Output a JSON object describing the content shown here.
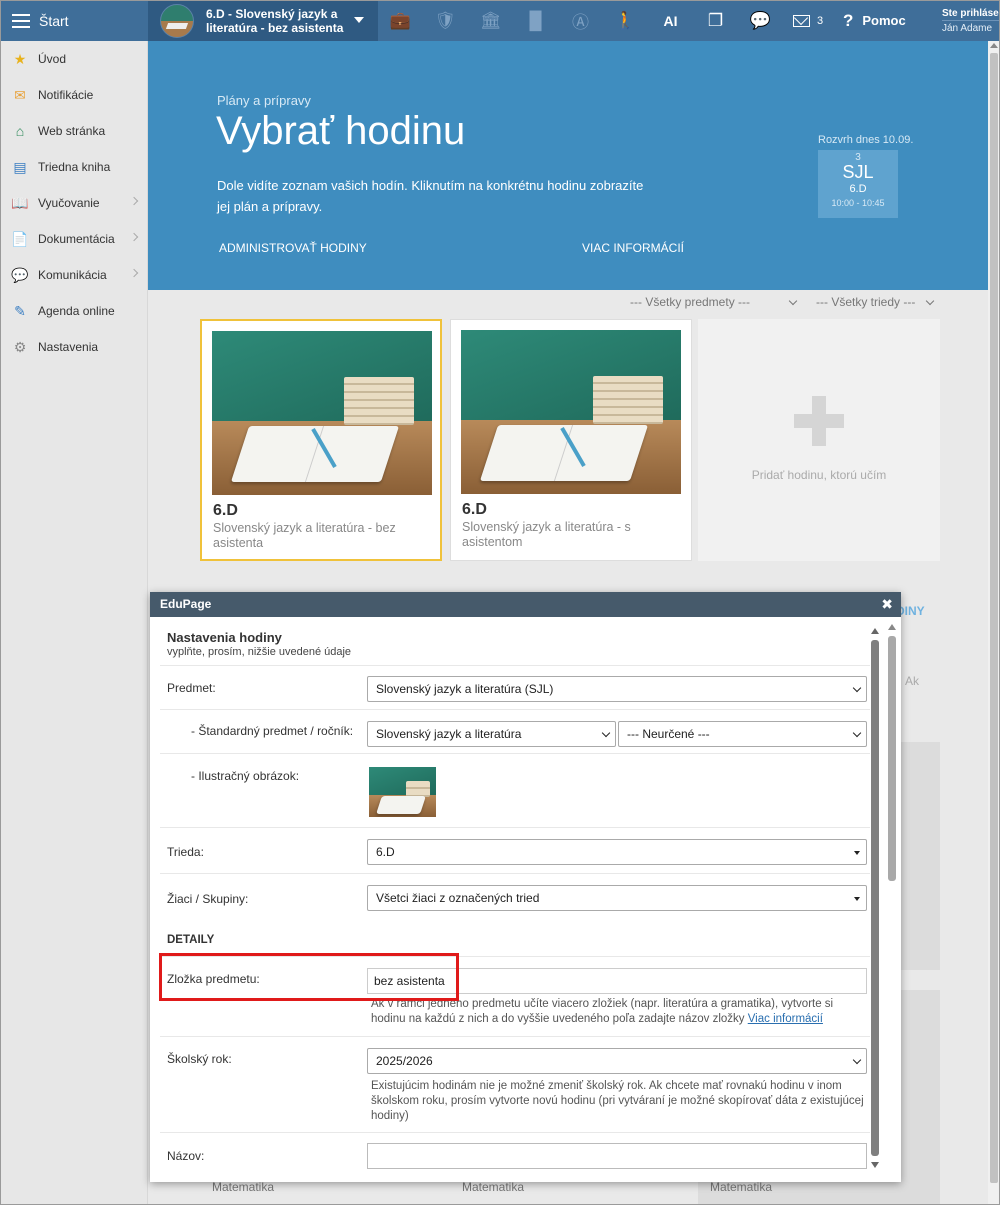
{
  "topbar": {
    "start_label": "Štart",
    "course_title": "6.D - Slovenský jazyk a literatúra - bez asistenta",
    "ai_label": "AI",
    "messages_count": "3",
    "help_label": "Pomoc",
    "user_line1": "Ste prihláse",
    "user_line2": "Ján Adame"
  },
  "sidebar": {
    "items": [
      {
        "label": "Úvod",
        "icon": "star-icon"
      },
      {
        "label": "Notifikácie",
        "icon": "envelope-icon"
      },
      {
        "label": "Web stránka",
        "icon": "home-icon"
      },
      {
        "label": "Triedna kniha",
        "icon": "book-icon"
      },
      {
        "label": "Vyučovanie",
        "icon": "open-book-icon"
      },
      {
        "label": "Dokumentácia",
        "icon": "document-icon"
      },
      {
        "label": "Komunikácia",
        "icon": "chat-icon"
      },
      {
        "label": "Agenda online",
        "icon": "pen-icon"
      },
      {
        "label": "Nastavenia",
        "icon": "gear-icon"
      }
    ]
  },
  "hero": {
    "subtitle": "Plány a prípravy",
    "title": "Vybrať hodinu",
    "description": "Dole vidíte zoznam vašich hodín. Kliknutím na konkrétnu hodinu zobrazíte jej plán a prípravy.",
    "link_admin": "ADMINISTROVAŤ HODINY",
    "link_more": "VIAC INFORMÁCIÍ",
    "schedule": {
      "label": "Rozvrh dnes 10.09.",
      "period": "3",
      "subject": "SJL",
      "class": "6.D",
      "time": "10:00 - 10:45"
    }
  },
  "filters": {
    "subjects": "--- Všetky predmety ---",
    "classes": "--- Všetky triedy ---"
  },
  "lessons": [
    {
      "class": "6.D",
      "subject": "Slovenský jazyk a literatúra - bez asistenta"
    },
    {
      "class": "6.D",
      "subject": "Slovenský jazyk a literatúra - s asistentom"
    }
  ],
  "add_lesson_label": "Pridať hodinu, ktorú učím",
  "background": {
    "side_link": "DINY",
    "side_text": "Ak",
    "bottom_labels": [
      "Matematika",
      "Matematika",
      "Matematika"
    ]
  },
  "dialog": {
    "title": "EduPage",
    "close": "✖",
    "section_title": "Nastavenia hodiny",
    "section_sub": "vyplňte, prosím, nižšie uvedené údaje",
    "predmet_label": "Predmet:",
    "predmet_value": "Slovenský jazyk a literatúra (SJL)",
    "standard_label": "- Štandardný predmet / ročník:",
    "standard_value": "Slovenský jazyk a literatúra",
    "rocnik_value": "--- Neurčené ---",
    "image_label": "- Ilustračný obrázok:",
    "trieda_label": "Trieda:",
    "trieda_value": "6.D",
    "ziaci_label": "Žiaci / Skupiny:",
    "ziaci_value": "Všetci žiaci z označených tried",
    "detaily": "DETAILY",
    "zlozka_label": "Zložka predmetu:",
    "zlozka_value": "bez asistenta",
    "zlozka_help": "Ak v rámci jedného predmetu učíte viacero zložiek (napr. literatúra a gramatika), vytvorte si hodinu na každú z nich a do vyššie uvedeného poľa zadajte názov zložky",
    "zlozka_help_link": "Viac informácií",
    "rok_label": "Školský rok:",
    "rok_value": "2025/2026",
    "rok_help": "Existujúcim hodinám nie je možné zmeniť školský rok. Ak chcete mať rovnakú hodinu v inom školskom roku, prosím vytvorte novú hodinu (pri vytváraní je možné skopírovať dáta z existujúcej hodiny)",
    "nazov_label": "Názov:",
    "nazov_value": ""
  },
  "colors": {
    "topbar": "#3f6e99",
    "hero": "#3f8dbf",
    "selected_border": "#f0c23a",
    "highlight": "#e01a1a",
    "dialog_header": "#465a6b"
  }
}
